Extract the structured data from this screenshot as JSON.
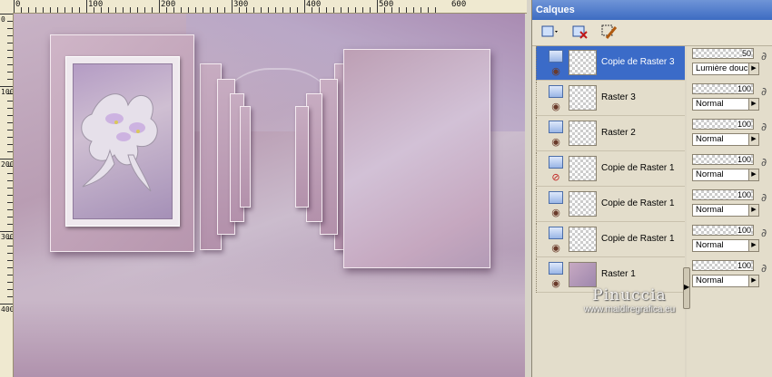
{
  "ruler": {
    "top_labels": [
      "0",
      "100",
      "200",
      "300",
      "400",
      "500",
      "600"
    ],
    "left_labels": [
      "0",
      "100",
      "200",
      "300",
      "400"
    ]
  },
  "panel": {
    "title": "Calques",
    "layers": [
      {
        "name": "Copie de Raster 3",
        "opacity": "50",
        "blend": "Lumière douce",
        "visible": true,
        "selected": true,
        "thumb": "checker"
      },
      {
        "name": "Raster 3",
        "opacity": "100",
        "blend": "Normal",
        "visible": true,
        "selected": false,
        "thumb": "checker"
      },
      {
        "name": "Raster 2",
        "opacity": "100",
        "blend": "Normal",
        "visible": true,
        "selected": false,
        "thumb": "checker"
      },
      {
        "name": "Copie de Raster 1",
        "opacity": "100",
        "blend": "Normal",
        "visible": false,
        "selected": false,
        "thumb": "checker"
      },
      {
        "name": "Copie de Raster 1",
        "opacity": "100",
        "blend": "Normal",
        "visible": true,
        "selected": false,
        "thumb": "checker"
      },
      {
        "name": "Copie de Raster 1",
        "opacity": "100",
        "blend": "Normal",
        "visible": true,
        "selected": false,
        "thumb": "checker"
      },
      {
        "name": "Raster 1",
        "opacity": "100",
        "blend": "Normal",
        "visible": true,
        "selected": false,
        "thumb": "art"
      }
    ]
  },
  "watermark": {
    "title": "Pinuccia",
    "url": "www.maidiregrafica.eu"
  },
  "colors": {
    "panel_title_bg": "#3d6bc2",
    "selected_layer_bg": "#3b6bc8",
    "canvas_mauve": "#b99db3"
  },
  "icons": {
    "new_layer": "new-layer-icon",
    "delete_layer": "delete-layer-icon",
    "edit_mask": "edit-mask-icon",
    "visible": "eye-icon",
    "hidden": "hidden-eye-icon",
    "link": "link-icon"
  }
}
